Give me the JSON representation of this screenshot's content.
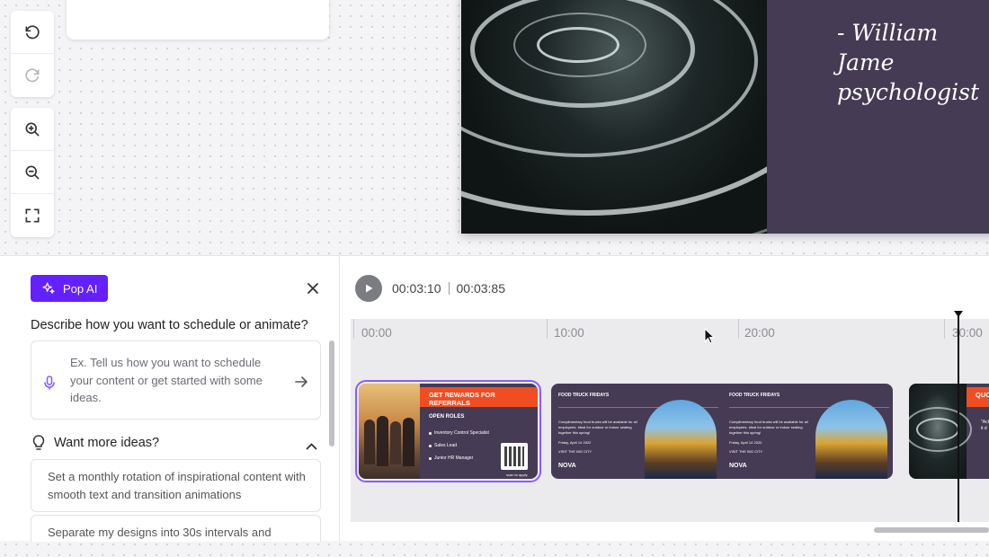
{
  "toolbar": {
    "undo": "undo-icon",
    "redo": "redo-icon",
    "zoom_in": "zoom-in-icon",
    "zoom_out": "zoom-out-icon",
    "fit": "fit-screen-icon"
  },
  "slide": {
    "quote_attribution": "- William Jame\npsychologist"
  },
  "ai_panel": {
    "button_label": "Pop AI",
    "title": "Describe how you want to schedule or animate?",
    "placeholder": "Ex. Tell us how you want to schedule your content or get started with some ideas.",
    "ideas_heading": "Want more ideas?",
    "ideas": [
      "Set a monthly rotation of inspirational content with smooth text and transition animations",
      "Separate my designs into 30s intervals and"
    ]
  },
  "timeline": {
    "current_time": "00:03:10",
    "total_time": "00:03:85",
    "ruler": [
      "00:00",
      "10:00",
      "20:00",
      "30:00"
    ],
    "clips": [
      {
        "banner": "GET REWARDS FOR REFERRALS",
        "heading": "OPEN ROLES",
        "roles": [
          "Inventory Control Specialist",
          "Sales Lead",
          "Junior HR Manager"
        ],
        "qr_caption": "scan to apply"
      },
      {
        "heading": "FOOD TRUCK FRIDAYS",
        "body": "Complimentary food trucks will be available for all employees. Ideal for outdoor or indoor seating together this spring!",
        "date": "Friday, April 14 2022",
        "cta": "VISIT THE BIG CITY",
        "brand": "NOVA"
      },
      {
        "heading": "FOOD TRUCK FRIDAYS",
        "body": "Complimentary food trucks will be available for all employees. Ideal for outdoor or indoor seating together this spring!",
        "date": "Friday, April 14 2022",
        "cta": "VISIT THE BIG CITY",
        "brand": "NOVA"
      },
      {
        "banner": "QUO",
        "snippet": "\"Act\nit d"
      }
    ]
  },
  "colors": {
    "accent": "#6420ff",
    "orange": "#f04e22",
    "slide_purple": "#453b54",
    "selection": "#8a5cff"
  }
}
